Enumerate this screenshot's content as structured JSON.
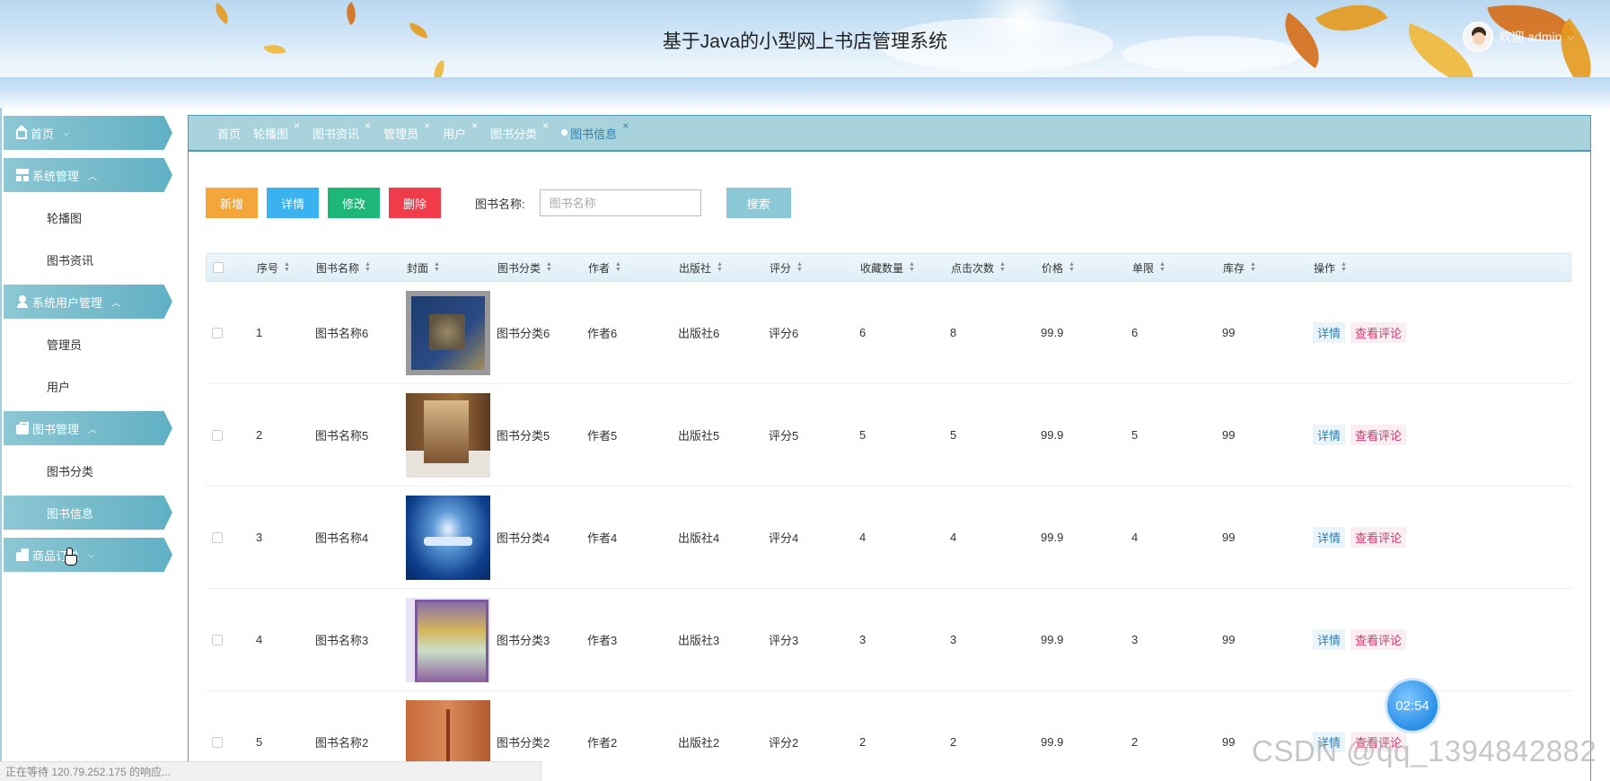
{
  "header": {
    "title": "基于Java的小型网上书店管理系统",
    "user_label": "欢迎 admin",
    "caret": "⌵"
  },
  "sidebar": {
    "home": "首页",
    "system": "系统管理",
    "system_items": [
      "轮播图",
      "图书资讯"
    ],
    "users": "系统用户管理",
    "user_items": [
      "管理员",
      "用户"
    ],
    "books": "图书管理",
    "book_items": [
      "图书分类",
      "图书信息"
    ],
    "orders": "商品订单"
  },
  "tabs": {
    "items": [
      "首页",
      "轮播图",
      "图书资讯",
      "管理员",
      "用户",
      "图书分类",
      "图书信息"
    ],
    "close": "×"
  },
  "toolbar": {
    "add": "新增",
    "detail": "详情",
    "edit": "修改",
    "delete": "删除",
    "search_label": "图书名称:",
    "search_placeholder": "图书名称",
    "search_button": "搜索"
  },
  "table": {
    "headers": [
      "序号",
      "图书名称",
      "封面",
      "图书分类",
      "作者",
      "出版社",
      "评分",
      "收藏数量",
      "点击次数",
      "价格",
      "单限",
      "库存",
      "操作"
    ],
    "rows": [
      {
        "no": "1",
        "name": "图书名称6",
        "category": "图书分类6",
        "author": "作者6",
        "publisher": "出版社6",
        "score": "评分6",
        "fav": "6",
        "clicks": "8",
        "price": "99.9",
        "limit": "6",
        "stock": "99"
      },
      {
        "no": "2",
        "name": "图书名称5",
        "category": "图书分类5",
        "author": "作者5",
        "publisher": "出版社5",
        "score": "评分5",
        "fav": "5",
        "clicks": "5",
        "price": "99.9",
        "limit": "5",
        "stock": "99"
      },
      {
        "no": "3",
        "name": "图书名称4",
        "category": "图书分类4",
        "author": "作者4",
        "publisher": "出版社4",
        "score": "评分4",
        "fav": "4",
        "clicks": "4",
        "price": "99.9",
        "limit": "4",
        "stock": "99"
      },
      {
        "no": "4",
        "name": "图书名称3",
        "category": "图书分类3",
        "author": "作者3",
        "publisher": "出版社3",
        "score": "评分3",
        "fav": "3",
        "clicks": "3",
        "price": "99.9",
        "limit": "3",
        "stock": "99"
      },
      {
        "no": "5",
        "name": "图书名称2",
        "category": "图书分类2",
        "author": "作者2",
        "publisher": "出版社2",
        "score": "评分2",
        "fav": "2",
        "clicks": "2",
        "price": "99.9",
        "limit": "2",
        "stock": "99"
      }
    ],
    "op_detail": "详情",
    "op_comment": "查看评论"
  },
  "overlay": {
    "timer": "02:54",
    "watermark": "CSDN @qq_1394842882",
    "status": "正在等待 120.79.252.175 的响应..."
  },
  "colors": {
    "accent": "#6fb7c8",
    "add": "#f4a63a",
    "detail": "#3ab2ef",
    "edit": "#1eb77a",
    "delete": "#ef3b4a"
  }
}
